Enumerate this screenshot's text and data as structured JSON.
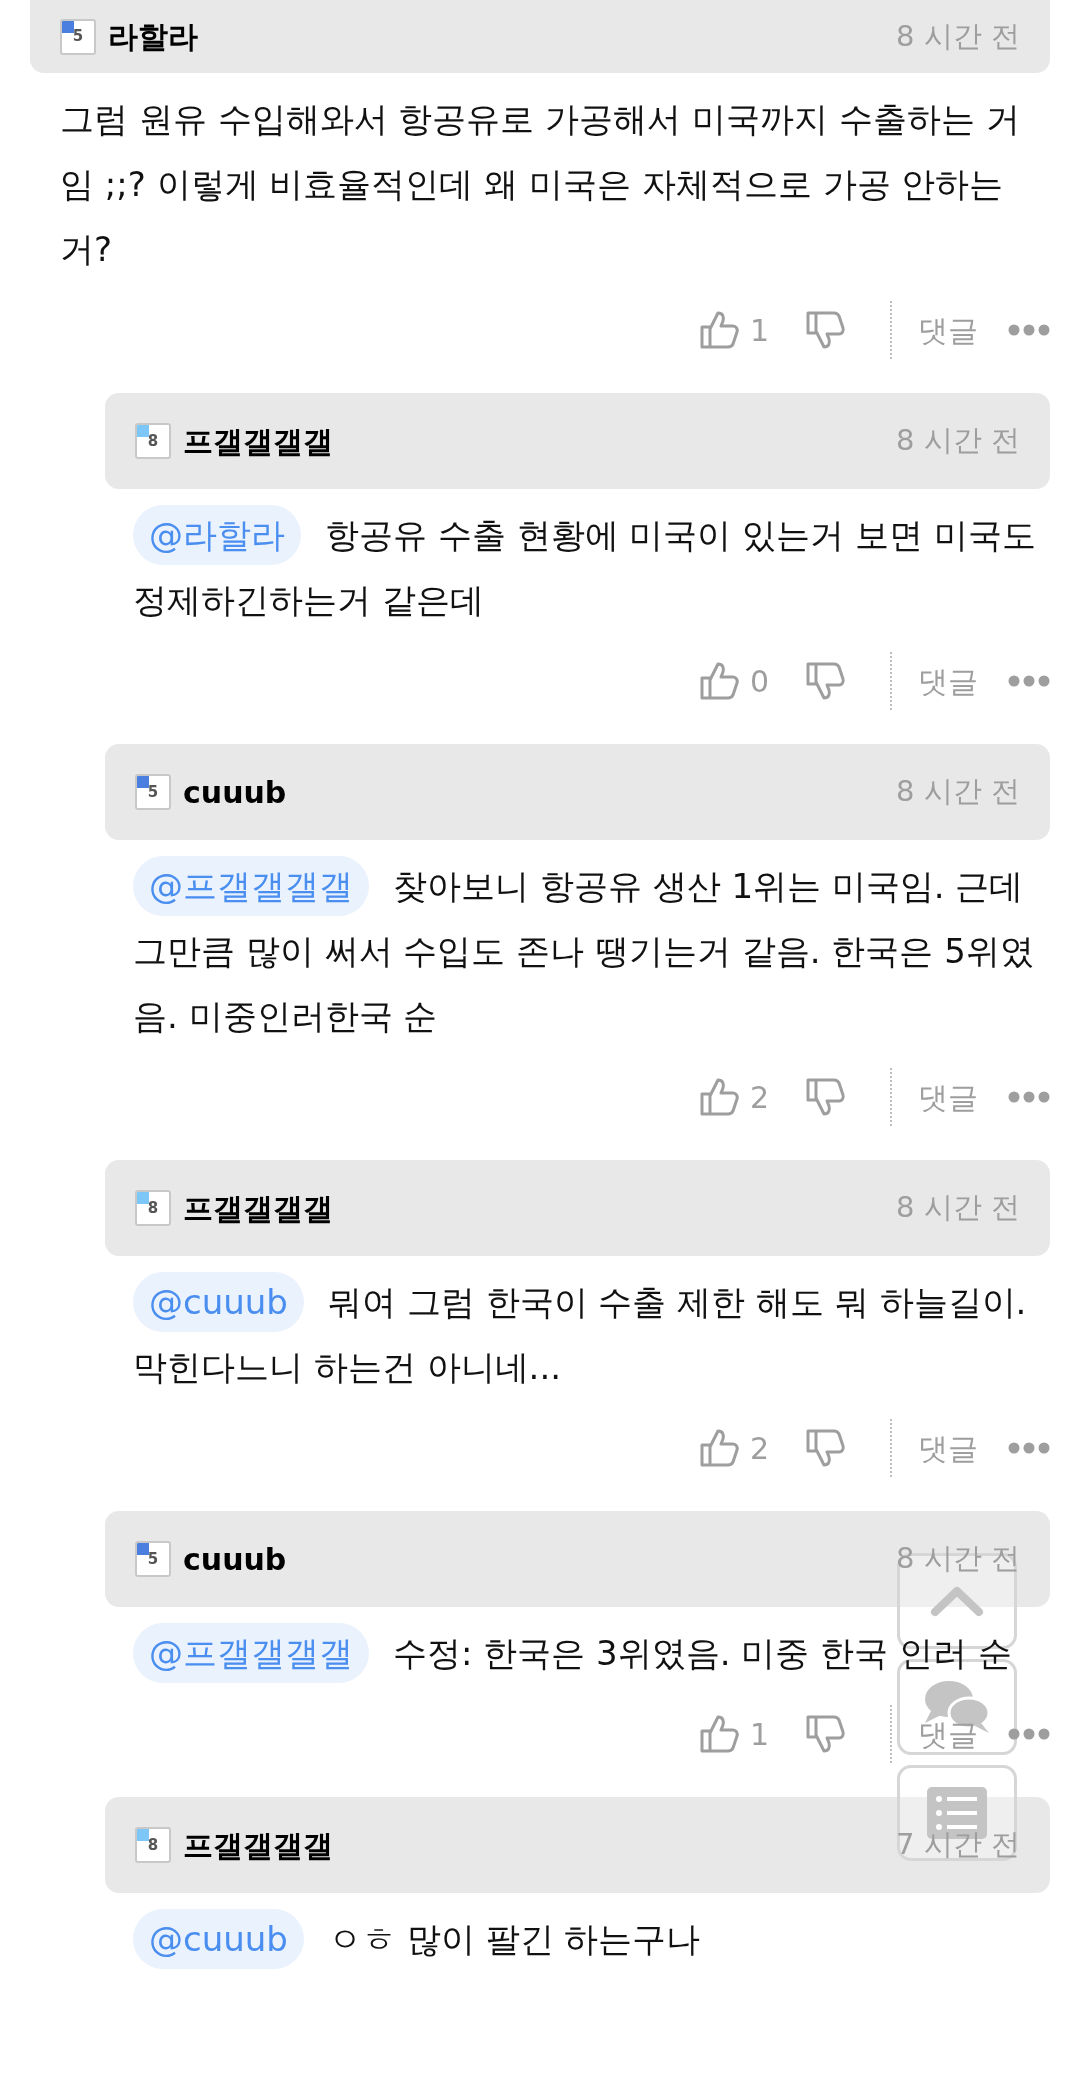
{
  "comments": [
    {
      "kind": "comment",
      "author": "라할라",
      "level": "5",
      "color": "#4a7fe0",
      "time": "8 시간 전",
      "text": "그럼 원유 수입해와서 항공유로 가공해서 미국까지 수출하는 거임 ;;? 이렇게 비효율적인데 왜 미국은 자체적으로 가공 안하는거?",
      "likes": "1",
      "reply_label": "댓글"
    },
    {
      "kind": "reply",
      "author": "프갤갤갤갤",
      "level": "8",
      "color": "#7cc6f8",
      "time": "8 시간 전",
      "mention": "@라할라",
      "text": "항공유 수출 현황에 미국이 있는거 보면 미국도 정제하긴하는거 같은데",
      "likes": "0",
      "reply_label": "댓글"
    },
    {
      "kind": "reply",
      "author": "cuuub",
      "level": "5",
      "color": "#4a7fe0",
      "time": "8 시간 전",
      "mention": "@프갤갤갤갤",
      "text": "찾아보니 항공유 생산 1위는 미국임. 근데 그만큼 많이 써서 수입도 존나 땡기는거 같음. 한국은 5위였음. 미중인러한국 순",
      "likes": "2",
      "reply_label": "댓글"
    },
    {
      "kind": "reply",
      "author": "프갤갤갤갤",
      "level": "8",
      "color": "#7cc6f8",
      "time": "8 시간 전",
      "mention": "@cuuub",
      "text": "뭐여 그럼 한국이 수출 제한 해도 뭐 하늘길이.막힌다느니 하는건 아니네...",
      "likes": "2",
      "reply_label": "댓글"
    },
    {
      "kind": "reply",
      "author": "cuuub",
      "level": "5",
      "color": "#4a7fe0",
      "time": "8 시간 전",
      "mention": "@프갤갤갤갤",
      "text": "수정: 한국은 3위였음. 미중 한국 인러 순",
      "likes": "1",
      "reply_label": "댓글"
    },
    {
      "kind": "reply",
      "author": "프갤갤갤갤",
      "level": "8",
      "color": "#7cc6f8",
      "time": "7 시간 전",
      "mention": "@cuuub",
      "text": "ㅇㅎ 많이 팔긴 하는구나"
    }
  ]
}
